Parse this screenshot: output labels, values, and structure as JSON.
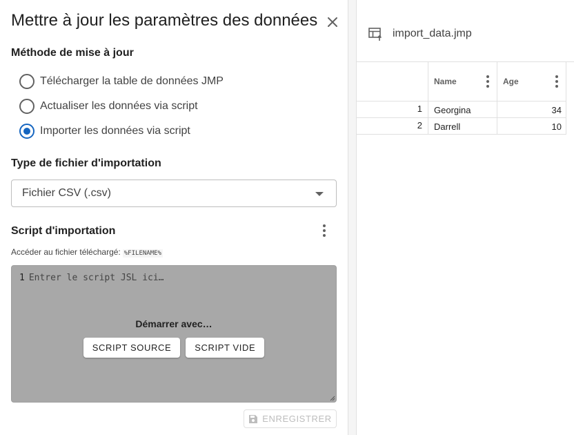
{
  "dialog": {
    "title": "Mettre à jour les paramètres des données",
    "update_method": {
      "label": "Méthode de mise à jour",
      "options": [
        {
          "label": "Télécharger la table de données JMP",
          "checked": false
        },
        {
          "label": "Actualiser les données via script",
          "checked": false
        },
        {
          "label": "Importer les données via script",
          "checked": true
        }
      ]
    },
    "file_type": {
      "label": "Type de fichier d'importation",
      "selected": "Fichier CSV (.csv)"
    },
    "import_script": {
      "label": "Script d'importation",
      "hint": "Accéder au fichier téléchargé:",
      "hint_code": "%FILENAME%",
      "editor": {
        "line_number": "1",
        "placeholder": "Entrer le script JSL ici…",
        "start_with": "Démarrer avec…",
        "source_script_button": "SCRIPT SOURCE",
        "empty_script_button": "SCRIPT VIDE"
      }
    },
    "save_button": "ENREGISTRER"
  },
  "preview": {
    "file_name": "import_data.jmp",
    "columns": [
      "Name",
      "Age"
    ],
    "rows": [
      {
        "index": "1",
        "name": "Georgina",
        "age": "34"
      },
      {
        "index": "2",
        "name": "Darrell",
        "age": "10"
      }
    ]
  },
  "colors": {
    "accent": "#1565c0",
    "editor_bg": "#a8a8a8",
    "disabled_text": "#bdbdbd"
  }
}
